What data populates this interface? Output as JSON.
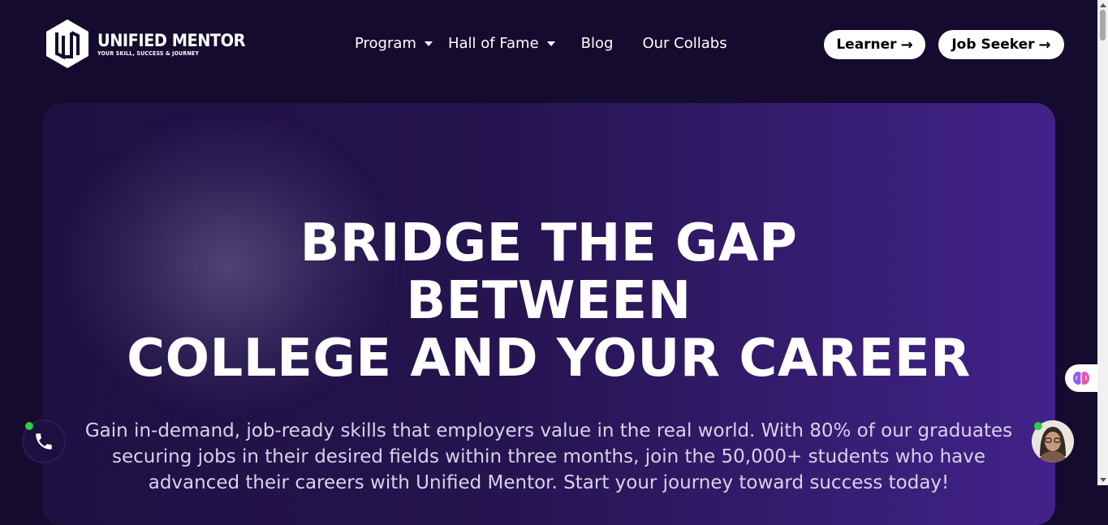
{
  "brand": {
    "name": "UNIFIED MENTOR",
    "tagline": "YOUR SKILL, SUCCESS & JOURNEY"
  },
  "nav": {
    "items": [
      {
        "label": "Program",
        "dropdown": true
      },
      {
        "label": "Hall of Fame",
        "dropdown": true
      },
      {
        "label": "Blog",
        "dropdown": false
      },
      {
        "label": "Our Collabs",
        "dropdown": false
      }
    ]
  },
  "header_buttons": {
    "learner": "Learner",
    "job_seeker": "Job Seeker"
  },
  "hero": {
    "title_lines": [
      "BRIDGE THE GAP",
      "BETWEEN",
      "COLLEGE AND YOUR CAREER"
    ],
    "description_lines": [
      "Gain in-demand, job-ready skills that employers value in the real world. With 80% of our graduates",
      "securing jobs in their desired fields within three months, join the 50,000+ students who have",
      "advanced their careers with Unified Mentor. Start your journey toward success today!"
    ]
  },
  "colors": {
    "page_bg": "#150b2e",
    "hero_gradient_start": "#1e1142",
    "hero_gradient_end": "#42228a",
    "online_dot": "#2ecc40"
  },
  "icons": [
    "logo-hexagon-icon",
    "chevron-down-icon",
    "arrow-right-icon",
    "phone-icon",
    "brain-icon"
  ]
}
